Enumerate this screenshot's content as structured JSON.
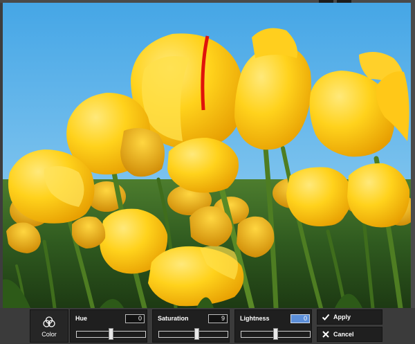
{
  "toolbar": {
    "color_tool": {
      "label": "Color",
      "icon": "color-circles-icon"
    },
    "sliders": [
      {
        "id": "hue",
        "label": "Hue",
        "value": "0",
        "position": 0.5
      },
      {
        "id": "saturation",
        "label": "Saturation",
        "value": "9",
        "position": 0.55
      },
      {
        "id": "lightness",
        "label": "Lightness",
        "value": "0",
        "position": 0.5
      }
    ],
    "apply_label": "Apply",
    "cancel_label": "Cancel"
  },
  "colors": {
    "toolbar_bg": "#3b3b3b",
    "panel_bg": "#1f1f1f",
    "active_input": "#5b8ed8",
    "sky": "#5fb3ea",
    "tulip": "#f4b800"
  }
}
